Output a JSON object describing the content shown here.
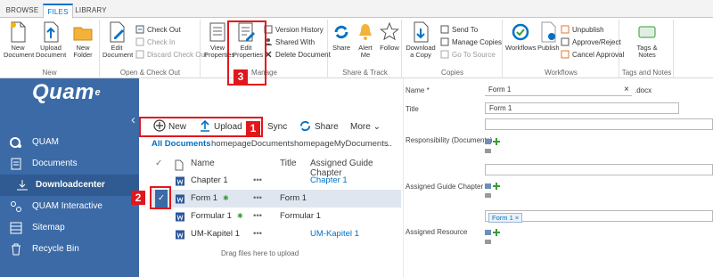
{
  "ribbon": {
    "tabs": [
      "BROWSE",
      "FILES",
      "LIBRARY"
    ],
    "active_tab": "FILES",
    "groups": {
      "new": {
        "label": "New",
        "new_document": "New Document",
        "upload_document": "Upload Document",
        "new_folder": "New Folder"
      },
      "open_checkout": {
        "label": "Open & Check Out",
        "edit_document": "Edit Document",
        "check_out": "Check Out",
        "check_in": "Check In",
        "discard_check_out": "Discard Check Out"
      },
      "manage": {
        "label": "Manage",
        "view_properties": "View Properties",
        "edit_properties": "Edit Properties",
        "version_history": "Version History",
        "shared_with": "Shared With",
        "delete_document": "Delete Document"
      },
      "share_track": {
        "label": "Share & Track",
        "share": "Share",
        "alert_me": "Alert Me",
        "follow": "Follow"
      },
      "copies": {
        "label": "Copies",
        "download_copy": "Download a Copy",
        "send_to": "Send To",
        "manage_copies": "Manage Copies",
        "go_to_source": "Go To Source"
      },
      "workflows": {
        "label": "Workflows",
        "workflows": "Workflows",
        "publish": "Publish",
        "unpublish": "Unpublish",
        "approve_reject": "Approve/Reject",
        "cancel_approval": "Cancel Approval"
      },
      "tags": {
        "label": "Tags and Notes",
        "tags_notes": "Tags & Notes"
      }
    }
  },
  "nav": {
    "logo": "Quam",
    "items": [
      {
        "label": "QUAM",
        "icon": "quam-icon"
      },
      {
        "label": "Documents",
        "icon": "documents-icon"
      },
      {
        "label": "Downloadcenter",
        "icon": "download-icon"
      },
      {
        "label": "QUAM Interactive",
        "icon": "interactive-icon"
      },
      {
        "label": "Sitemap",
        "icon": "sitemap-icon"
      },
      {
        "label": "Recycle Bin",
        "icon": "recycle-bin-icon"
      }
    ],
    "selected": "Downloadcenter"
  },
  "library": {
    "toolbar": {
      "new": "New",
      "upload": "Upload",
      "sync": "Sync",
      "share": "Share",
      "more": "More"
    },
    "views": [
      "All Documents",
      "homepageDocuments",
      "homepageMyDocuments",
      "..."
    ],
    "columns": [
      "Name",
      "Title",
      "Assigned Guide Chapter"
    ],
    "rows": [
      {
        "name": "Chapter 1",
        "title": "",
        "chapter": "Chapter 1",
        "selected": false,
        "new": false
      },
      {
        "name": "Form 1",
        "title": "Form 1",
        "chapter": "",
        "selected": true,
        "new": true
      },
      {
        "name": "Formular 1",
        "title": "Formular 1",
        "chapter": "",
        "selected": false,
        "new": true
      },
      {
        "name": "UM-Kapitel 1",
        "title": "",
        "chapter": "UM-Kapitel 1",
        "selected": false,
        "new": false
      }
    ],
    "drop_hint": "Drag files here to upload"
  },
  "properties": {
    "name_label": "Name *",
    "name_value": "Form 1",
    "name_ext": ".docx",
    "clear": "×",
    "title_label": "Title",
    "title_value": "Form 1",
    "responsibility_label": "Responsibility (Documents)",
    "assigned_guide_label": "Assigned Guide Chapter",
    "assigned_resource_label": "Assigned Resource",
    "resource_tag": "Form 1 ×"
  },
  "callouts": [
    "1",
    "2",
    "3"
  ],
  "colors": {
    "nav_bg": "#3b6aa6",
    "accent": "#0072c6",
    "highlight": "#e3161b"
  }
}
